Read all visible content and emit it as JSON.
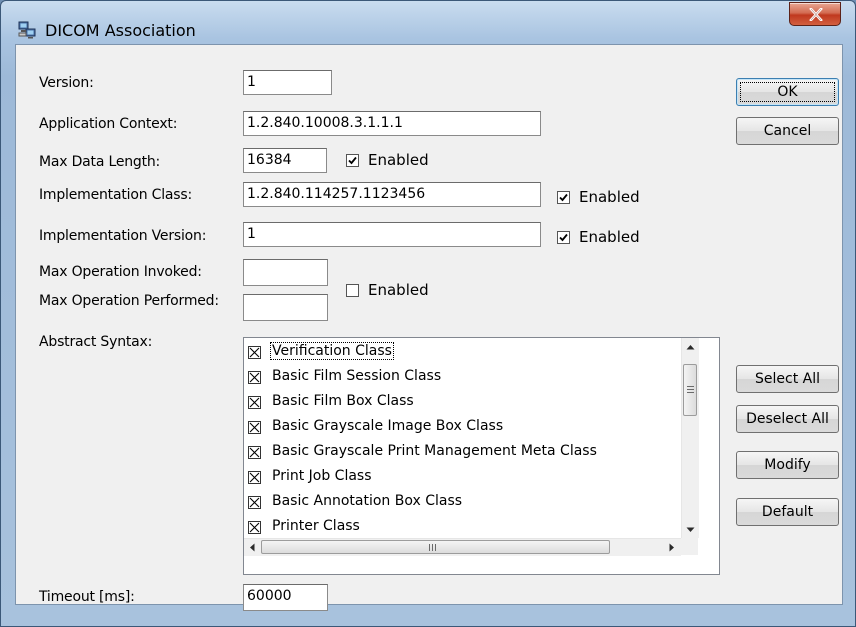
{
  "window": {
    "title": "DICOM Association"
  },
  "fields": {
    "version": {
      "label": "Version:",
      "value": "1"
    },
    "application_context": {
      "label": "Application Context:",
      "value": "1.2.840.10008.3.1.1.1"
    },
    "max_data_length": {
      "label": "Max Data Length:",
      "value": "16384",
      "enabled_label": "Enabled",
      "enabled": true
    },
    "implementation_class": {
      "label": "Implementation Class:",
      "value": "1.2.840.114257.1123456",
      "enabled_label": "Enabled",
      "enabled": true
    },
    "implementation_version": {
      "label": "Implementation Version:",
      "value": "1",
      "enabled_label": "Enabled",
      "enabled": true
    },
    "max_operation_invoked": {
      "label": "Max Operation Invoked:",
      "value": ""
    },
    "max_operation_performed": {
      "label": "Max Operation Performed:",
      "value": ""
    },
    "max_operation_enabled_label": "Enabled",
    "max_operation_enabled": false,
    "timeout": {
      "label": "Timeout [ms]:",
      "value": "60000"
    }
  },
  "abstract_syntax": {
    "label": "Abstract Syntax:",
    "items": [
      "Verification Class",
      "Basic Film Session Class",
      "Basic Film Box Class",
      "Basic Grayscale Image Box Class",
      "Basic Grayscale Print Management Meta Class",
      "Print Job Class",
      "Basic Annotation Box Class",
      "Printer Class"
    ],
    "focused_index": 0
  },
  "buttons": {
    "ok": "OK",
    "cancel": "Cancel",
    "select_all": "Select All",
    "deselect_all": "Deselect All",
    "modify": "Modify",
    "default": "Default"
  },
  "colors": {
    "title_gradient_top": "#c9dcef",
    "client_bg": "#f0f0f0",
    "close_button": "#c0391f"
  },
  "icons": {
    "app": "network-computers-icon",
    "close": "close-x-icon",
    "check": "checkmark-icon",
    "item_check": "x-checkbox-icon"
  }
}
